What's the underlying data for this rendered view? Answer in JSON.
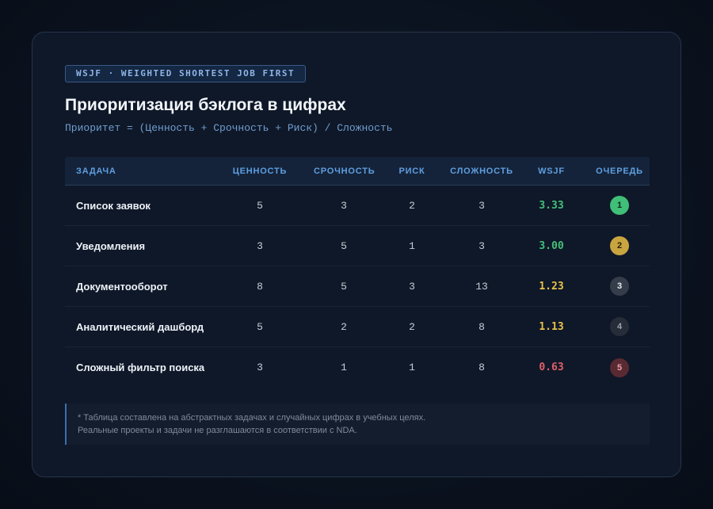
{
  "badge": "WSJF · WEIGHTED SHORTEST JOB FIRST",
  "title": "Приоритизация бэклога в цифрах",
  "formula": "Приоритет = (Ценность + Срочность + Риск) / Сложность",
  "table": {
    "headers": {
      "task": "ЗАДАЧА",
      "value": "ЦЕННОСТЬ",
      "urgency": "СРОЧНОСТЬ",
      "risk": "РИСК",
      "complexity": "СЛОЖНОСТЬ",
      "wsjf": "WSJF",
      "queue": "ОЧЕРЕДЬ"
    },
    "rows": [
      {
        "task": "Список заявок",
        "value": "5",
        "urgency": "3",
        "risk": "2",
        "complexity": "3",
        "wsjf": "3.33",
        "queue": "1",
        "wsjf_color": "#43c07a",
        "queue_bg": "#3fbf78",
        "queue_fg": "#0f2a1a"
      },
      {
        "task": "Уведомления",
        "value": "3",
        "urgency": "5",
        "risk": "1",
        "complexity": "3",
        "wsjf": "3.00",
        "queue": "2",
        "wsjf_color": "#43c07a",
        "queue_bg": "#c9a540",
        "queue_fg": "#2c2208"
      },
      {
        "task": "Документооборот",
        "value": "8",
        "urgency": "5",
        "risk": "3",
        "complexity": "13",
        "wsjf": "1.23",
        "queue": "3",
        "wsjf_color": "#e8c24a",
        "queue_bg": "#363d4a",
        "queue_fg": "#e6e9ee"
      },
      {
        "task": "Аналитический дашборд",
        "value": "5",
        "urgency": "2",
        "risk": "2",
        "complexity": "8",
        "wsjf": "1.13",
        "queue": "4",
        "wsjf_color": "#e8c24a",
        "queue_bg": "#262d38",
        "queue_fg": "#9aa3b0"
      },
      {
        "task": "Сложный фильтр поиска",
        "value": "3",
        "urgency": "1",
        "risk": "1",
        "complexity": "8",
        "wsjf": "0.63",
        "queue": "5",
        "wsjf_color": "#e0606a",
        "queue_bg": "#5a2a33",
        "queue_fg": "#e8a0a6"
      }
    ]
  },
  "note": {
    "line1": "* Таблица составлена на абстрактных задачах и случайных цифрах в учебных целях.",
    "line2": "Реальные проекты и задачи не разглашаются в соответствии с NDA."
  }
}
